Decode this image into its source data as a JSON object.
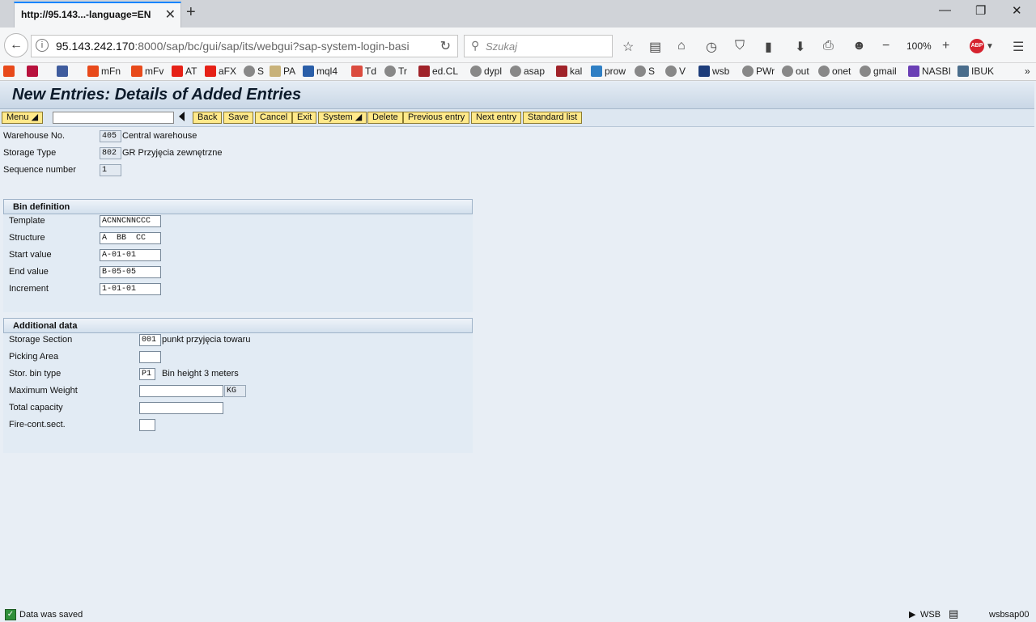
{
  "browser": {
    "tab_title": "http://95.143...-language=EN",
    "url_host": "95.143.242.170",
    "url_rest": ":8000/sap/bc/gui/sap/its/webgui?sap-system-login-basi",
    "search_placeholder": "Szukaj",
    "zoom": "100%",
    "abp_label": "ABP",
    "bookmarks": [
      "mFn",
      "mFv",
      "AT",
      "aFX",
      "S",
      "PA",
      "mql4",
      "Td",
      "Tr",
      "ed.CL",
      "dypl",
      "asap",
      "kal",
      "prow",
      "S",
      "V",
      "wsb",
      "PWr",
      "out",
      "onet",
      "gmail",
      "NASBI",
      "IBUK"
    ]
  },
  "sap": {
    "title": "New Entries: Details of Added Entries",
    "toolbar": {
      "menu": "Menu",
      "back": "Back",
      "save": "Save",
      "cancel": "Cancel",
      "exit": "Exit",
      "system": "System",
      "delete": "Delete",
      "previous": "Previous entry",
      "next": "Next entry",
      "standard_list": "Standard list"
    },
    "header": {
      "warehouse_label": "Warehouse No.",
      "warehouse_value": "405",
      "warehouse_desc": "Central warehouse",
      "storage_type_label": "Storage Type",
      "storage_type_value": "802",
      "storage_type_desc": "GR Przyjęcia zewnętrzne",
      "sequence_label": "Sequence number",
      "sequence_value": "1"
    },
    "bin_definition": {
      "title": "Bin definition",
      "template_label": "Template",
      "template_value": "ACNNCNNCCC",
      "structure_label": "Structure",
      "structure_value": "A  BB  CC",
      "start_label": "Start value",
      "start_value": "A-01-01",
      "end_label": "End value",
      "end_value": "B-05-05",
      "increment_label": "Increment",
      "increment_value": "1-01-01"
    },
    "additional_data": {
      "title": "Additional data",
      "section_label": "Storage Section",
      "section_value": "001",
      "section_desc": "punkt przyjęcia towaru",
      "picking_label": "Picking Area",
      "picking_value": "",
      "bin_type_label": "Stor. bin type",
      "bin_type_value": "P1",
      "bin_type_desc": "Bin height 3 meters",
      "max_weight_label": "Maximum Weight",
      "max_weight_value": "",
      "weight_unit": "KG",
      "total_capacity_label": "Total capacity",
      "total_capacity_value": "",
      "fire_label": "Fire-cont.sect.",
      "fire_value": ""
    },
    "status": {
      "message": "Data was saved",
      "system": "WSB",
      "server": "wsbsap00"
    }
  }
}
